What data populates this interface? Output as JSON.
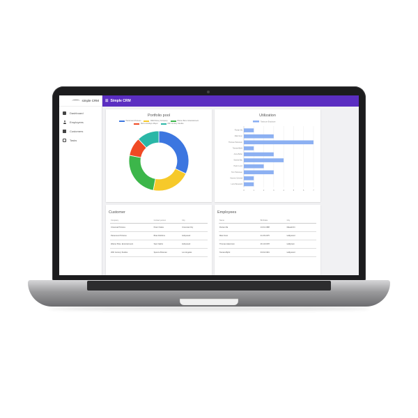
{
  "app": {
    "logo_text": "simple CRM",
    "title": "Simple CRM",
    "menu_icon": "hamburger-icon"
  },
  "sidebar": {
    "items": [
      {
        "label": "Dashboard",
        "icon": "dashboard-icon"
      },
      {
        "label": "Employees",
        "icon": "person-icon"
      },
      {
        "label": "Customers",
        "icon": "building-icon"
      },
      {
        "label": "Tasks",
        "icon": "task-icon"
      }
    ]
  },
  "colors": {
    "topbar": "#5b2ec1",
    "blue": "#3c76e0",
    "yellow": "#f6c92a",
    "green": "#3cb64a",
    "red": "#f04a24",
    "teal": "#2ab7a7",
    "bar": "#8cb0f2"
  },
  "portfolio": {
    "title": "Portfolio pool",
    "chart_data": {
      "type": "pie",
      "title": "Portfolio pool",
      "legend_position": "top",
      "categories": [
        "Paramount Pictures",
        "Walt Disney Company",
        "Warner Bros. Entertainment",
        "Metro-Goldwyn-Mayer",
        "20th Century Studios"
      ],
      "values": [
        32,
        21,
        25,
        10,
        12
      ],
      "colors": [
        "#3c76e0",
        "#f6c92a",
        "#3cb64a",
        "#f04a24",
        "#2ab7a7"
      ]
    }
  },
  "utilization": {
    "title": "Utilization",
    "chart_data": {
      "type": "bar",
      "orientation": "horizontal",
      "title": "Utilization",
      "legend_position": "top",
      "series": [
        {
          "name": "Tasks per Employee",
          "values": [
            1,
            3,
            7,
            1,
            3,
            4,
            2,
            3,
            1,
            1
          ]
        }
      ],
      "categories": [
        "Florian Ma",
        "Mats Sven",
        "Thomas Halvorson",
        "Tamara Björk",
        "Anna Buller",
        "Sandra Bau",
        "Pietro Lucci",
        "Tom Halvorsen",
        "Hannes Schmidt",
        "Lucio Benedetti"
      ],
      "xlim": [
        0,
        7
      ],
      "xticks": [
        "0",
        "1",
        "2",
        "3",
        "4",
        "5",
        "6",
        "7"
      ]
    }
  },
  "customer": {
    "title": "Customer",
    "columns": [
      "Company",
      "Contact person",
      "City"
    ],
    "rows": [
      [
        "Universal Pictures",
        "Peter Clarke",
        "Universal City"
      ],
      [
        "Paramount Pictures",
        "Brian Robbins",
        "Hollywood"
      ],
      [
        "Warner Bros. Entertainment",
        "Sam Natrisi",
        "Hollywood"
      ],
      [
        "20th Century Studios",
        "Spence Brosnan",
        "Los Angeles"
      ]
    ]
  },
  "employees": {
    "title": "Employees",
    "columns": [
      "Name",
      "Birthdate",
      "City"
    ],
    "rows": [
      [
        "Florian Ma",
        "13.01.1988",
        "Maastricht"
      ],
      [
        "Mats Sven",
        "21.06.1975",
        "Hollywood"
      ],
      [
        "Thomas Halvorson",
        "26.10.1978",
        "Hollytown"
      ],
      [
        "Tamara Björk",
        "03.02.1991",
        "Hollywood"
      ]
    ]
  }
}
